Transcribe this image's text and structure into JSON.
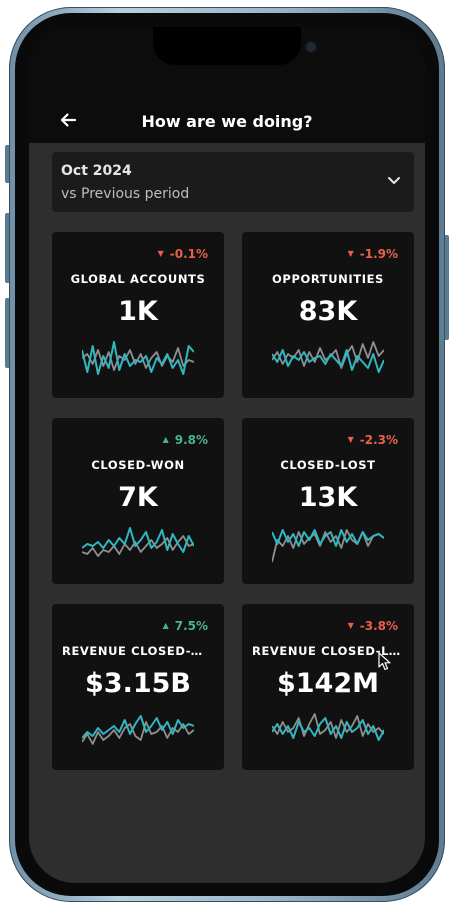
{
  "header": {
    "title": "How are we doing?"
  },
  "period": {
    "main": "Oct 2024",
    "sub": "vs Previous period"
  },
  "cards": [
    {
      "label": "GLOBAL ACCOUNTS",
      "value": "1K",
      "delta": "-0.1%",
      "direction": "down",
      "teal": [
        0.3,
        0.85,
        0.2,
        0.9,
        0.45,
        0.75,
        0.1,
        0.8,
        0.4,
        0.7,
        0.55,
        0.6,
        0.45,
        0.85,
        0.5,
        0.65,
        0.4,
        0.75,
        0.55,
        0.9,
        0.2,
        0.35
      ],
      "gray": [
        0.5,
        0.4,
        0.65,
        0.3,
        0.7,
        0.35,
        0.8,
        0.45,
        0.55,
        0.3,
        0.65,
        0.4,
        0.75,
        0.5,
        0.35,
        0.7,
        0.45,
        0.6,
        0.25,
        0.7,
        0.55,
        0.6
      ]
    },
    {
      "label": "OPPORTUNITIES",
      "value": "83K",
      "delta": "-1.9%",
      "direction": "down",
      "teal": [
        0.4,
        0.6,
        0.3,
        0.7,
        0.45,
        0.55,
        0.35,
        0.6,
        0.5,
        0.45,
        0.65,
        0.4,
        0.55,
        0.7,
        0.3,
        0.8,
        0.45,
        0.6,
        0.75,
        0.4,
        0.85,
        0.55
      ],
      "gray": [
        0.55,
        0.35,
        0.65,
        0.4,
        0.5,
        0.3,
        0.7,
        0.35,
        0.6,
        0.25,
        0.55,
        0.45,
        0.3,
        0.75,
        0.4,
        0.2,
        0.6,
        0.15,
        0.5,
        0.1,
        0.45,
        0.3
      ]
    },
    {
      "label": "CLOSED-WON",
      "value": "7K",
      "delta": "9.8%",
      "direction": "up",
      "teal": [
        0.6,
        0.5,
        0.55,
        0.45,
        0.6,
        0.4,
        0.55,
        0.35,
        0.5,
        0.1,
        0.55,
        0.4,
        0.2,
        0.6,
        0.45,
        0.15,
        0.65,
        0.25,
        0.5,
        0.7,
        0.3,
        0.55
      ],
      "gray": [
        0.7,
        0.75,
        0.6,
        0.8,
        0.65,
        0.7,
        0.55,
        0.75,
        0.5,
        0.65,
        0.45,
        0.7,
        0.55,
        0.4,
        0.6,
        0.5,
        0.35,
        0.65,
        0.45,
        0.3,
        0.55,
        0.5
      ]
    },
    {
      "label": "CLOSED-LOST",
      "value": "13K",
      "delta": "-2.3%",
      "direction": "down",
      "teal": [
        0.2,
        0.5,
        0.15,
        0.45,
        0.25,
        0.55,
        0.2,
        0.4,
        0.15,
        0.5,
        0.3,
        0.2,
        0.55,
        0.15,
        0.45,
        0.25,
        0.5,
        0.2,
        0.4,
        0.3,
        0.25,
        0.35
      ],
      "gray": [
        0.95,
        0.4,
        0.55,
        0.3,
        0.6,
        0.2,
        0.5,
        0.35,
        0.25,
        0.55,
        0.2,
        0.45,
        0.3,
        0.6,
        0.15,
        0.4,
        0.5,
        0.2,
        0.55,
        0.3,
        0.25,
        0.35
      ]
    },
    {
      "label": "REVENUE CLOSED-W...",
      "value": "$3.15B",
      "delta": "7.5%",
      "direction": "up",
      "teal": [
        0.7,
        0.55,
        0.65,
        0.45,
        0.6,
        0.5,
        0.4,
        0.55,
        0.25,
        0.6,
        0.35,
        0.15,
        0.55,
        0.4,
        0.2,
        0.5,
        0.3,
        0.6,
        0.25,
        0.45,
        0.35,
        0.4
      ],
      "gray": [
        0.8,
        0.6,
        0.85,
        0.55,
        0.75,
        0.65,
        0.5,
        0.7,
        0.45,
        0.35,
        0.65,
        0.75,
        0.3,
        0.6,
        0.55,
        0.4,
        0.7,
        0.45,
        0.55,
        0.35,
        0.6,
        0.5
      ]
    },
    {
      "label": "REVENUE CLOSED-LO...",
      "value": "$142M",
      "delta": "-3.8%",
      "direction": "down",
      "teal": [
        0.55,
        0.35,
        0.6,
        0.4,
        0.7,
        0.3,
        0.55,
        0.45,
        0.65,
        0.35,
        0.2,
        0.6,
        0.4,
        0.7,
        0.3,
        0.55,
        0.45,
        0.25,
        0.6,
        0.4,
        0.75,
        0.5
      ],
      "gray": [
        0.4,
        0.6,
        0.3,
        0.55,
        0.45,
        0.2,
        0.65,
        0.35,
        0.1,
        0.6,
        0.5,
        0.3,
        0.7,
        0.25,
        0.55,
        0.4,
        0.15,
        0.65,
        0.35,
        0.55,
        0.45,
        0.6
      ]
    }
  ],
  "colors": {
    "teal": "#2fb7c2",
    "gray": "#8f8f8f"
  },
  "icons": {
    "back": "arrow-left-icon",
    "dropdown": "chevron-down-icon"
  }
}
